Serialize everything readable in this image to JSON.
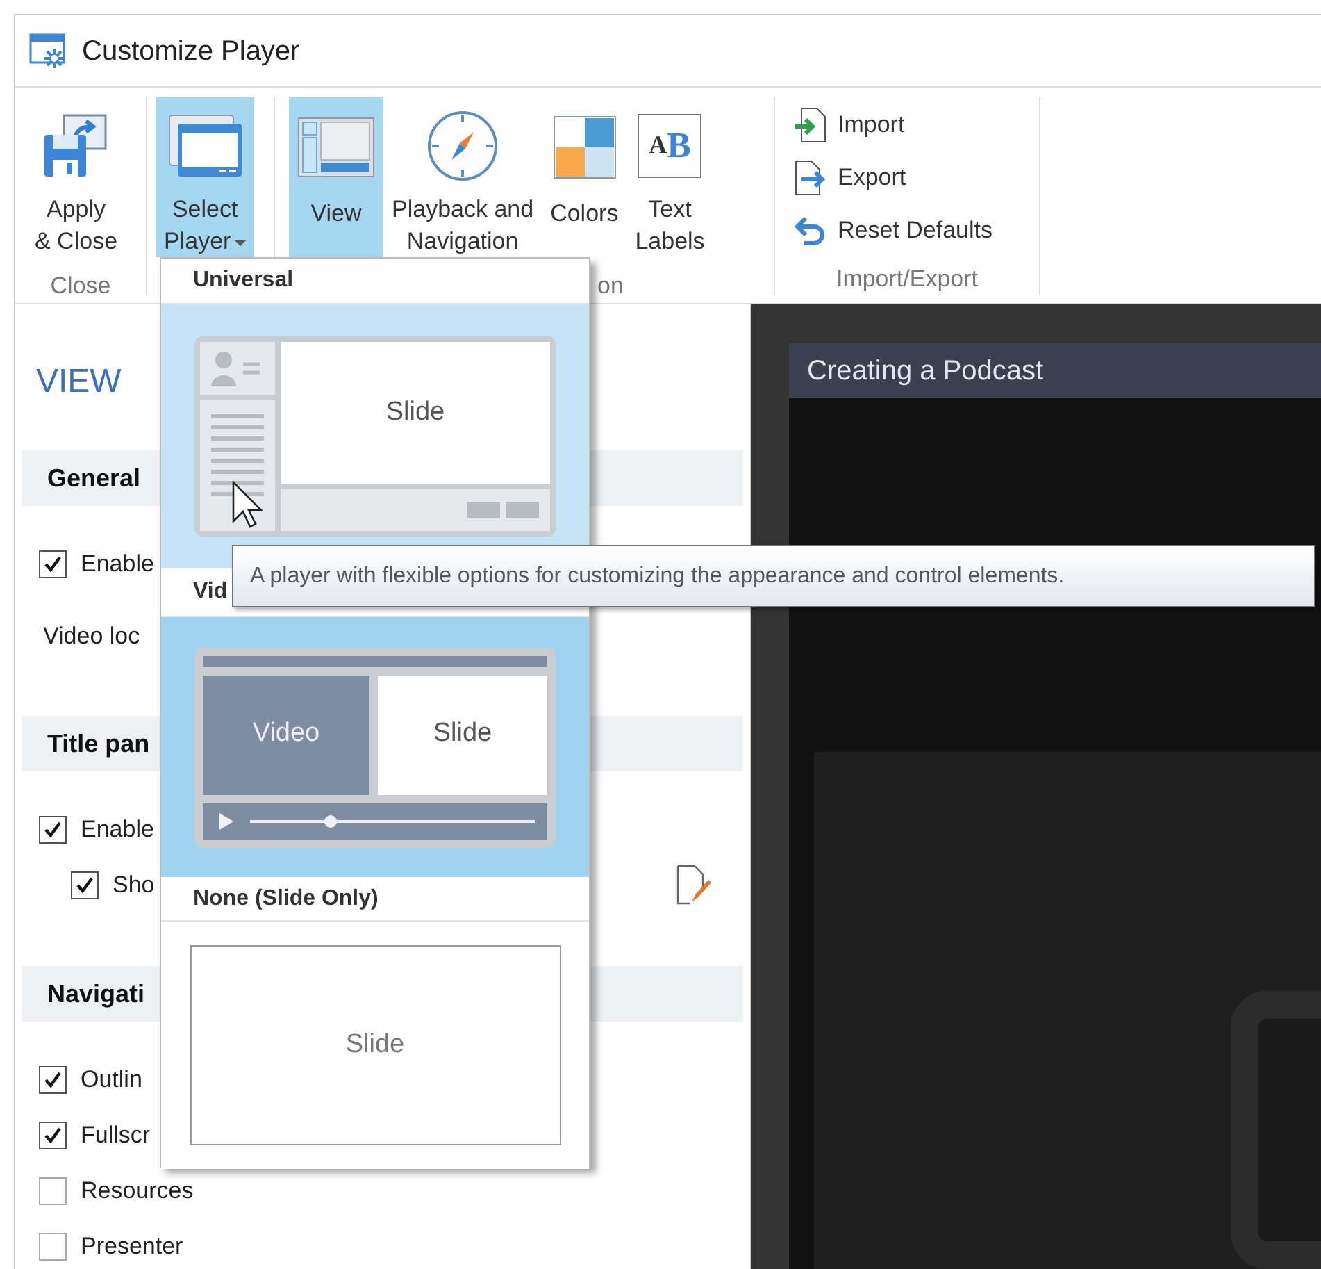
{
  "window": {
    "title": "Customize Player"
  },
  "ribbon": {
    "groups": [
      {
        "label": "Close",
        "buttons": [
          {
            "label": "Apply\n& Close",
            "selected": false,
            "dropdown": false
          }
        ]
      },
      {
        "buttons": [
          {
            "label": "Select\nPlayer",
            "selected": true,
            "dropdown": true
          }
        ]
      },
      {
        "label": "on",
        "buttons": [
          {
            "label": "View",
            "selected": true,
            "dropdown": false
          },
          {
            "label": "Playback and\nNavigation",
            "selected": false,
            "dropdown": false
          },
          {
            "label": "Colors",
            "selected": false,
            "dropdown": false
          },
          {
            "label": "Text\nLabels",
            "icon_text": "AB",
            "selected": false,
            "dropdown": false
          }
        ]
      },
      {
        "label": "Import/Export",
        "small_buttons": [
          {
            "label": "Import"
          },
          {
            "label": "Export"
          },
          {
            "label": "Reset Defaults"
          }
        ]
      }
    ]
  },
  "left_panel": {
    "heading": "VIEW",
    "sections": [
      {
        "title": "General",
        "rows": [
          {
            "kind": "checkbox",
            "label": "Enable",
            "checked": true
          },
          {
            "kind": "text",
            "label": "Video loc"
          }
        ]
      },
      {
        "title": "Title pan",
        "rows": [
          {
            "kind": "checkbox",
            "label": "Enable",
            "checked": true,
            "children": [
              {
                "kind": "checkbox",
                "label": "Sho",
                "checked": true,
                "editable": true
              }
            ]
          }
        ]
      },
      {
        "title": "Navigati",
        "rows": [
          {
            "kind": "checkbox",
            "label": "Outlin",
            "checked": true
          },
          {
            "kind": "checkbox",
            "label": "Fullscr",
            "checked": true
          },
          {
            "kind": "checkbox",
            "label": "Resources",
            "checked": false
          },
          {
            "kind": "checkbox",
            "label": "Presenter",
            "checked": false
          }
        ]
      }
    ]
  },
  "preview": {
    "title": "Creating a Podcast"
  },
  "player_dropdown": {
    "sections": [
      {
        "title": "Universal",
        "item": {
          "kind": "universal",
          "selected": false,
          "hovered": true,
          "labels": [
            "Slide"
          ]
        }
      },
      {
        "title": "Vid",
        "item": {
          "kind": "video_slide",
          "selected": true,
          "hovered": false,
          "labels": [
            "Video",
            "Slide"
          ]
        }
      },
      {
        "title": "None (Slide Only)",
        "item": {
          "kind": "slide_only",
          "selected": false,
          "hovered": false,
          "labels": [
            "Slide"
          ]
        }
      }
    ]
  },
  "tooltip": {
    "text": "A player with flexible options for customizing the appearance and control elements."
  }
}
